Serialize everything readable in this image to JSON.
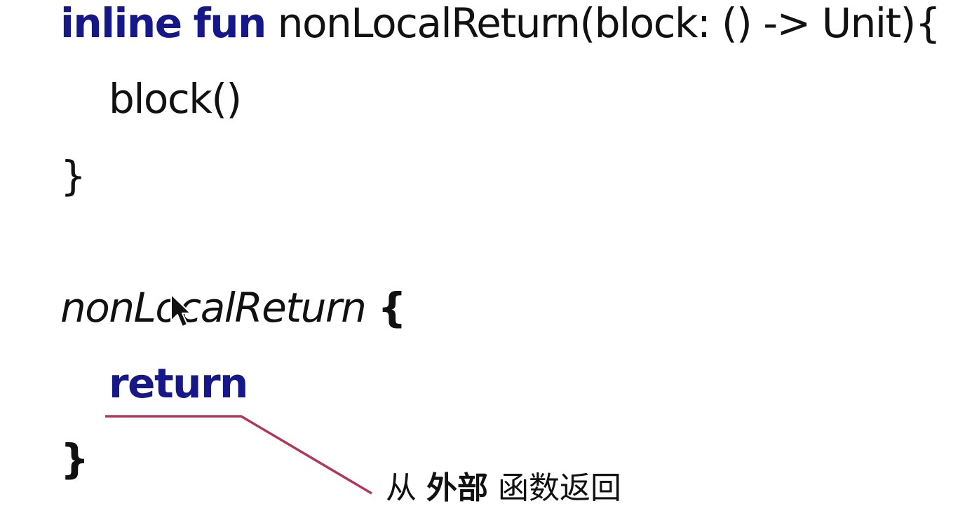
{
  "code": {
    "line1": {
      "keyword_inline": "inline",
      "keyword_fun": "fun",
      "signature": "nonLocalReturn(block: () -> Unit){"
    },
    "line2": "block()",
    "line3": "}",
    "line4": {
      "call_name": "nonLocalReturn",
      "open_brace": "{"
    },
    "line5": {
      "keyword_return": "return"
    },
    "line6": "}"
  },
  "annotation": {
    "prefix": "从",
    "emphasis": "外部",
    "suffix": "函数返回"
  },
  "colors": {
    "keyword": "#16188a",
    "annotation_line": "#b0385a",
    "text": "#111111"
  },
  "icons": {
    "cursor": "mouse-pointer-icon"
  }
}
